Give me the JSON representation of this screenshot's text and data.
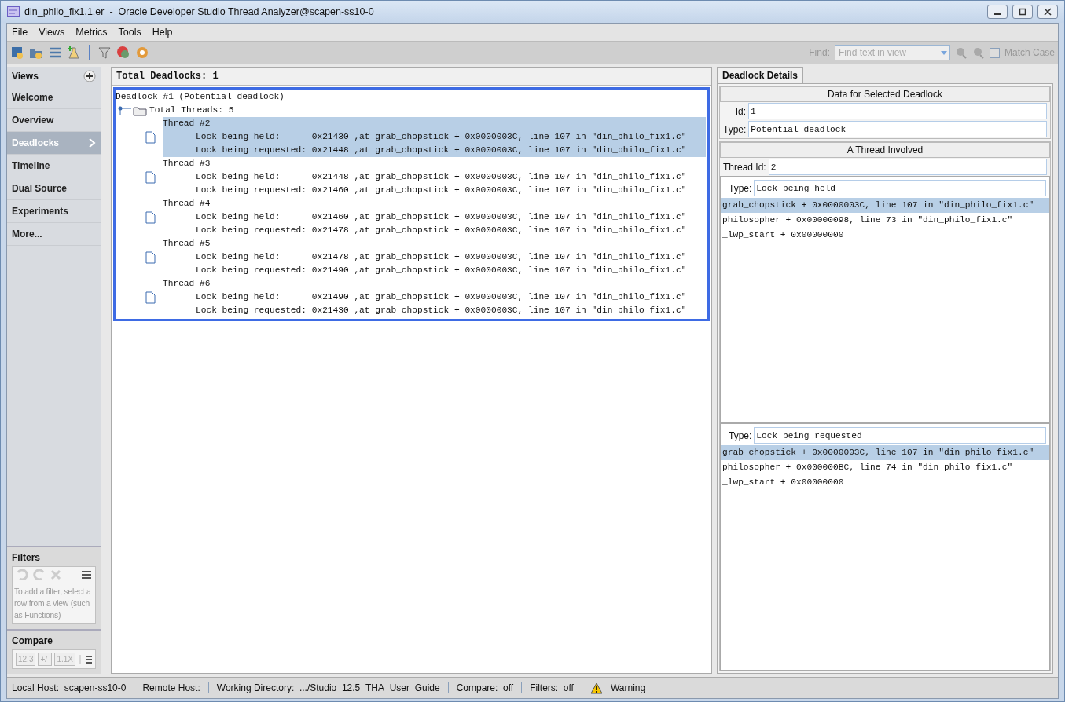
{
  "window": {
    "title": "din_philo_fix1.1.er  -  Oracle Developer Studio Thread Analyzer@scapen-ss10-0"
  },
  "menu": [
    "File",
    "Views",
    "Metrics",
    "Tools",
    "Help"
  ],
  "find": {
    "label": "Find:",
    "placeholder": "Find text in view",
    "match_case": {
      "label": "Match Case",
      "checked": false
    }
  },
  "sidebar": {
    "title": "Views",
    "items": [
      {
        "label": "Welcome",
        "selected": false
      },
      {
        "label": "Overview",
        "selected": false
      },
      {
        "label": "Deadlocks",
        "selected": true
      },
      {
        "label": "Timeline",
        "selected": false
      },
      {
        "label": "Dual Source",
        "selected": false
      },
      {
        "label": "Experiments",
        "selected": false
      },
      {
        "label": "More...",
        "selected": false
      }
    ],
    "filters": {
      "title": "Filters",
      "hint": "To add a filter, select a row from a view (such as Functions)"
    },
    "compare": {
      "title": "Compare",
      "buttons": [
        "12.3",
        "+/-",
        "1.1X"
      ]
    }
  },
  "main": {
    "header": "Total Deadlocks: 1",
    "tree": {
      "label": "Deadlock #1 (Potential deadlock)",
      "children": [
        {
          "label": "Total Threads: 5",
          "expanded": true,
          "children": [
            {
              "title": "Thread #2",
              "selected": true,
              "lines": [
                "Lock being held:      0x21430 ,at grab_chopstick + 0x0000003C, line 107 in \"din_philo_fix1.c\"",
                "Lock being requested: 0x21448 ,at grab_chopstick + 0x0000003C, line 107 in \"din_philo_fix1.c\""
              ]
            },
            {
              "title": "Thread #3",
              "selected": false,
              "lines": [
                "Lock being held:      0x21448 ,at grab_chopstick + 0x0000003C, line 107 in \"din_philo_fix1.c\"",
                "Lock being requested: 0x21460 ,at grab_chopstick + 0x0000003C, line 107 in \"din_philo_fix1.c\""
              ]
            },
            {
              "title": "Thread #4",
              "selected": false,
              "lines": [
                "Lock being held:      0x21460 ,at grab_chopstick + 0x0000003C, line 107 in \"din_philo_fix1.c\"",
                "Lock being requested: 0x21478 ,at grab_chopstick + 0x0000003C, line 107 in \"din_philo_fix1.c\""
              ]
            },
            {
              "title": "Thread #5",
              "selected": false,
              "lines": [
                "Lock being held:      0x21478 ,at grab_chopstick + 0x0000003C, line 107 in \"din_philo_fix1.c\"",
                "Lock being requested: 0x21490 ,at grab_chopstick + 0x0000003C, line 107 in \"din_philo_fix1.c\""
              ]
            },
            {
              "title": "Thread #6",
              "selected": false,
              "lines": [
                "Lock being held:      0x21490 ,at grab_chopstick + 0x0000003C, line 107 in \"din_philo_fix1.c\"",
                "Lock being requested: 0x21430 ,at grab_chopstick + 0x0000003C, line 107 in \"din_philo_fix1.c\""
              ]
            }
          ]
        }
      ]
    }
  },
  "details": {
    "tab": "Deadlock Details",
    "section": "Data for Selected Deadlock",
    "id_label": "Id:",
    "id": "1",
    "type_label": "Type:",
    "type": "Potential deadlock",
    "thread_section": "A Thread Involved",
    "thread_id_label": "Thread Id:",
    "thread_id": "2",
    "stacks": [
      {
        "type_label": "Type:",
        "type": "Lock being held",
        "frames": [
          {
            "text": "grab_chopstick + 0x0000003C, line 107 in \"din_philo_fix1.c\"",
            "selected": true
          },
          {
            "text": "philosopher + 0x00000098, line 73 in \"din_philo_fix1.c\"",
            "selected": false
          },
          {
            "text": "_lwp_start + 0x00000000",
            "selected": false
          }
        ]
      },
      {
        "type_label": "Type:",
        "type": "Lock being requested",
        "frames": [
          {
            "text": "grab_chopstick + 0x0000003C, line 107 in \"din_philo_fix1.c\"",
            "selected": true
          },
          {
            "text": "philosopher + 0x000000BC, line 74 in \"din_philo_fix1.c\"",
            "selected": false
          },
          {
            "text": "_lwp_start + 0x00000000",
            "selected": false
          }
        ]
      }
    ]
  },
  "status_bar": [
    {
      "label": "Local Host:",
      "value": "scapen-ss10-0"
    },
    {
      "label": "Remote Host:"
    },
    {
      "label": "Working Directory:",
      "value": ".../Studio_12.5_THA_User_Guide"
    },
    {
      "label": "Compare:",
      "value": "off"
    },
    {
      "label": "Filters:",
      "value": "off"
    }
  ],
  "warning": "Warning"
}
